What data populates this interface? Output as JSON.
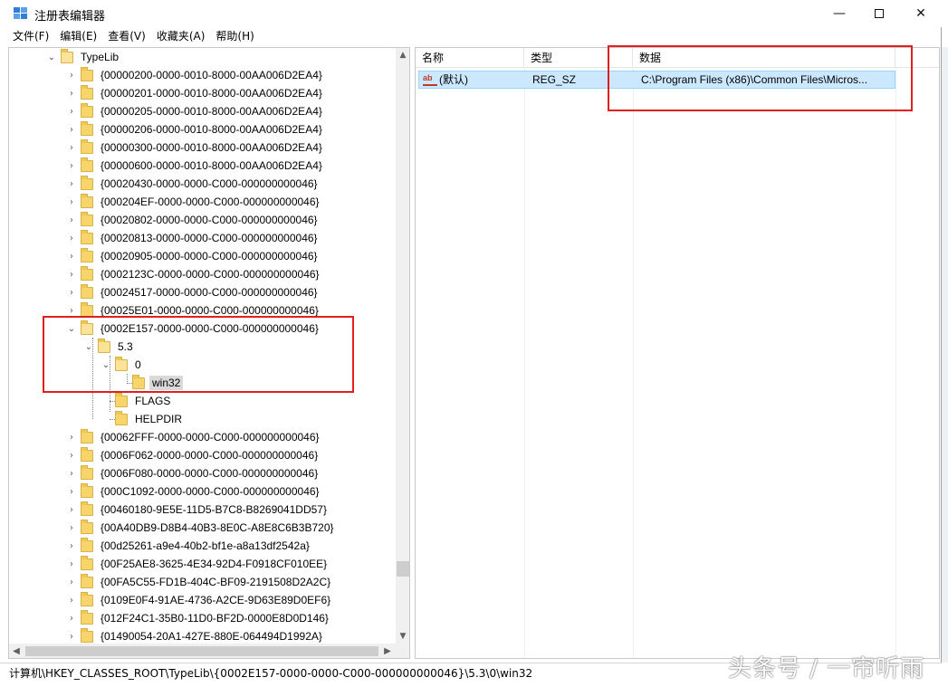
{
  "window": {
    "title": "注册表编辑器",
    "minimize_symbol": "—",
    "close_symbol": "✕"
  },
  "menu": [
    "文件(F)",
    "编辑(E)",
    "查看(V)",
    "收藏夹(A)",
    "帮助(H)"
  ],
  "tree": {
    "root_label": "TypeLib",
    "keys_before": [
      "{00000200-0000-0010-8000-00AA006D2EA4}",
      "{00000201-0000-0010-8000-00AA006D2EA4}",
      "{00000205-0000-0010-8000-00AA006D2EA4}",
      "{00000206-0000-0010-8000-00AA006D2EA4}",
      "{00000300-0000-0010-8000-00AA006D2EA4}",
      "{00000600-0000-0010-8000-00AA006D2EA4}",
      "{00020430-0000-0000-C000-000000000046}",
      "{000204EF-0000-0000-C000-000000000046}",
      "{00020802-0000-0000-C000-000000000046}",
      "{00020813-0000-0000-C000-000000000046}",
      "{00020905-0000-0000-C000-000000000046}",
      "{0002123C-0000-0000-C000-000000000046}",
      "{00024517-0000-0000-C000-000000000046}",
      "{00025E01-0000-0000-C000-000000000046}"
    ],
    "expanded_key": "{0002E157-0000-0000-C000-000000000046}",
    "version_key": "5.3",
    "lcid_key": "0",
    "selected_key": "win32",
    "flags_key": "FLAGS",
    "helpdir_key": "HELPDIR",
    "keys_after": [
      "{00062FFF-0000-0000-C000-000000000046}",
      "{0006F062-0000-0000-C000-000000000046}",
      "{0006F080-0000-0000-C000-000000000046}",
      "{000C1092-0000-0000-C000-000000000046}",
      "{00460180-9E5E-11D5-B7C8-B8269041DD57}",
      "{00A40DB9-D8B4-40B3-8E0C-A8E8C6B3B720}",
      "{00d25261-a9e4-40b2-bf1e-a8a13df2542a}",
      "{00F25AE8-3625-4E34-92D4-F0918CF010EE}",
      "{00FA5C55-FD1B-404C-BF09-2191508D2A2C}",
      "{0109E0F4-91AE-4736-A2CE-9D63E89D0EF6}",
      "{012F24C1-35B0-11D0-BF2D-0000E8D0D146}",
      "{01490054-20A1-427E-880E-064494D1992A}"
    ]
  },
  "values_list": {
    "columns": {
      "name": "名称",
      "type": "类型",
      "data": "数据"
    },
    "rows": [
      {
        "icon": "ab",
        "name": "(默认)",
        "type": "REG_SZ",
        "data": "C:\\Program Files (x86)\\Common Files\\Micros..."
      }
    ]
  },
  "statusbar": {
    "path": "计算机\\HKEY_CLASSES_ROOT\\TypeLib\\{0002E157-0000-0000-C000-000000000046}\\5.3\\0\\win32"
  },
  "watermark": "头条号 / 一帘听雨",
  "colors": {
    "highlight_box": "#e02020",
    "selected_row": "#cce8ff",
    "folder": "#f7d56b"
  }
}
